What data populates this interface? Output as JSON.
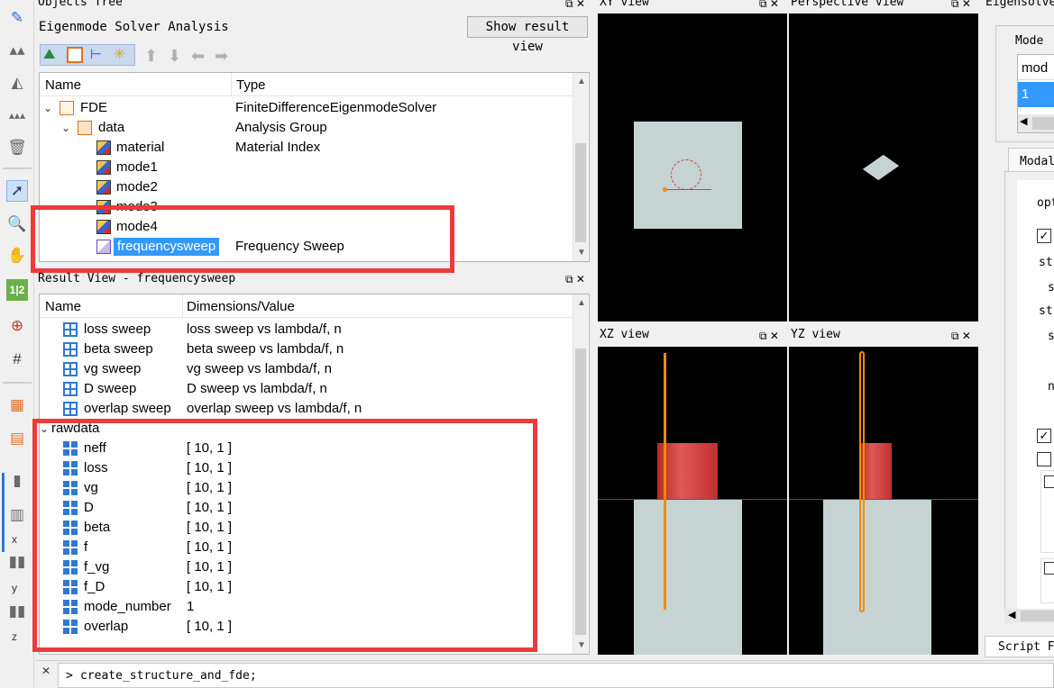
{
  "objects_tree": {
    "dock_title": "Objects Tree",
    "analysis_label": "Eigenmode Solver Analysis",
    "show_result_button": "Show result view",
    "columns": [
      "Name",
      "Type"
    ],
    "rows": [
      {
        "name": "FDE",
        "type": "FiniteDifferenceEigenmodeSolver"
      },
      {
        "name": "data",
        "type": "Analysis Group"
      },
      {
        "name": "material",
        "type": "Material Index"
      },
      {
        "name": "mode1",
        "type": ""
      },
      {
        "name": "mode2",
        "type": ""
      },
      {
        "name": "mode3",
        "type": ""
      },
      {
        "name": "mode4",
        "type": ""
      },
      {
        "name": "frequencysweep",
        "type": "Frequency Sweep"
      }
    ]
  },
  "result_view": {
    "dock_title": "Result View - frequencysweep",
    "columns": [
      "Name",
      "Dimensions/Value"
    ],
    "sweep_rows": [
      {
        "name": "loss sweep",
        "value": "loss sweep  vs lambda/f, n"
      },
      {
        "name": "beta sweep",
        "value": "beta sweep  vs lambda/f, n"
      },
      {
        "name": "vg sweep",
        "value": "vg sweep  vs lambda/f, n"
      },
      {
        "name": "D sweep",
        "value": "D sweep  vs lambda/f, n"
      },
      {
        "name": "overlap sweep",
        "value": "overlap sweep  vs lambda/f, n"
      }
    ],
    "group_label": "rawdata",
    "raw_rows": [
      {
        "name": "neff",
        "value": "[ 10, 1 ]"
      },
      {
        "name": "loss",
        "value": "[ 10, 1 ]"
      },
      {
        "name": "vg",
        "value": "[ 10, 1 ]"
      },
      {
        "name": "D",
        "value": "[ 10, 1 ]"
      },
      {
        "name": "beta",
        "value": "[ 10, 1 ]"
      },
      {
        "name": "f",
        "value": "[ 10, 1 ]"
      },
      {
        "name": "f_vg",
        "value": "[ 10, 1 ]"
      },
      {
        "name": "f_D",
        "value": "[ 10, 1 ]"
      },
      {
        "name": "mode_number",
        "value": "1"
      },
      {
        "name": "overlap",
        "value": "[ 10, 1 ]"
      }
    ]
  },
  "views": {
    "xy": "XY view",
    "perspective": "Perspective view",
    "xz": "XZ view",
    "yz": "YZ view",
    "dock_buttons": "⧉ ✕"
  },
  "eigensolver": {
    "dock_title": "Eigensolve",
    "mode_label": "Mode",
    "mode_header": "mod",
    "mode_value": "1",
    "modal_tab": "Modal",
    "option_fragments": [
      "opt",
      "st",
      "s",
      "st",
      "s",
      "n"
    ],
    "script_tab": "Script F"
  },
  "console": {
    "prompt": ">",
    "command": "create_structure_and_fde;"
  },
  "left_toolbar": {
    "axis_labels": [
      "x",
      "y",
      "z"
    ]
  },
  "colors": {
    "selection": "#3399ff",
    "highlight_box": "#ee3a3a",
    "orange_line": "#f28c00",
    "red_block": "#d83a3a",
    "substrate": "#c5d3d3"
  }
}
